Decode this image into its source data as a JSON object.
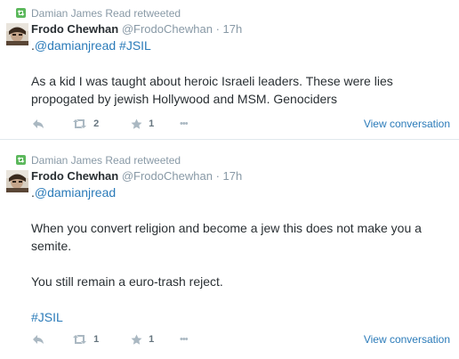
{
  "tweets": [
    {
      "retweeted_by": "Damian James Read retweeted",
      "author_name": "Frodo Chewhan",
      "author_handle": "@FrodoChewhan",
      "time": "· 17h",
      "reply_prefix": ".",
      "reply_to": "@damianjread",
      "reply_hashtag": "#JSIL",
      "text_lines": [
        "As a kid I was taught about heroic Israeli leaders. These were lies propogated by jewish Hollywood and MSM. Genociders"
      ],
      "retweet_count": "2",
      "favorite_count": "1",
      "more": "•••",
      "view_conversation": "View conversation"
    },
    {
      "retweeted_by": "Damian James Read retweeted",
      "author_name": "Frodo Chewhan",
      "author_handle": "@FrodoChewhan",
      "time": "· 17h",
      "reply_prefix": ".",
      "reply_to": "@damianjread",
      "paragraph_1": "When you convert religion and become a jew this does not make you a semite.",
      "paragraph_2": "You still remain a euro-trash reject.",
      "hashtag": "#JSIL",
      "retweet_count": "1",
      "favorite_count": "1",
      "more": "•••",
      "view_conversation": "View conversation"
    }
  ],
  "icons": {
    "retweet_badge_color": "#5cb85c",
    "link_color": "#2b7bb9"
  }
}
